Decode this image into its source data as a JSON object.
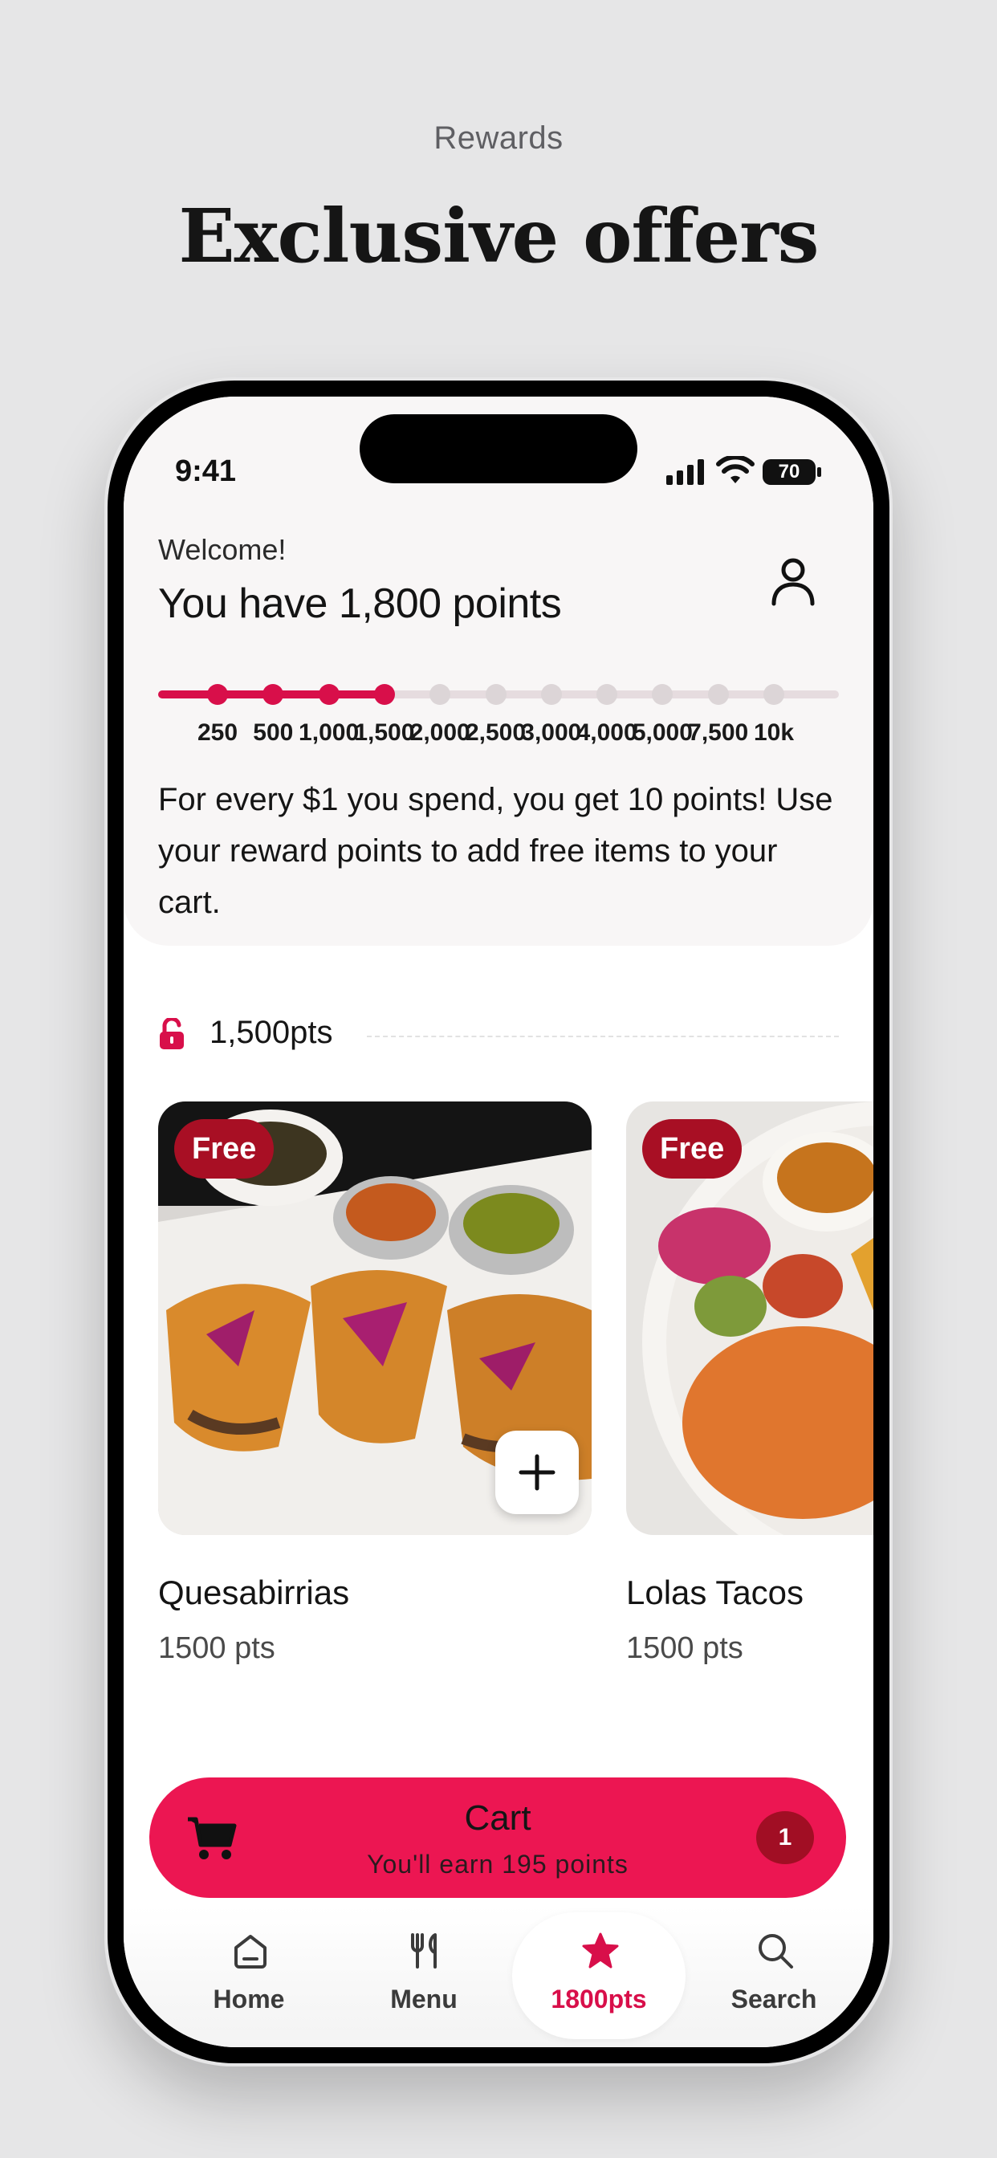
{
  "promo": {
    "subtitle": "Rewards",
    "title": "Exclusive offers"
  },
  "status_bar": {
    "time": "9:41",
    "battery": "70"
  },
  "header": {
    "welcome": "Welcome!",
    "points_title": "You have 1,800 points",
    "user_icon": "user-icon"
  },
  "progress": {
    "current_points": 1800,
    "milestones": [
      "250",
      "500",
      "1,000",
      "1,500",
      "2,000",
      "2,500",
      "3,000",
      "4,000",
      "5,000",
      "7,500",
      "10k"
    ],
    "reached": 4,
    "accent_color": "#d80f4a"
  },
  "description": "For every $1 you spend, you get 10 points! Use your reward points to add free items to your cart.",
  "tier": {
    "label": "1,500pts",
    "icon": "lock-open-icon"
  },
  "items": [
    {
      "badge": "Free",
      "name": "Quesabirrias",
      "points": "1500 pts"
    },
    {
      "badge": "Free",
      "name": "Lolas Tacos",
      "points": "1500 pts"
    }
  ],
  "cart": {
    "title": "Cart",
    "subtitle": "You'll earn 195 points",
    "count": "1",
    "color": "#ec1652"
  },
  "tabs": [
    {
      "label": "Home",
      "icon": "home-icon"
    },
    {
      "label": "Menu",
      "icon": "utensils-icon"
    },
    {
      "label": "1800pts",
      "icon": "star-icon",
      "active": true
    },
    {
      "label": "Search",
      "icon": "search-icon"
    }
  ]
}
